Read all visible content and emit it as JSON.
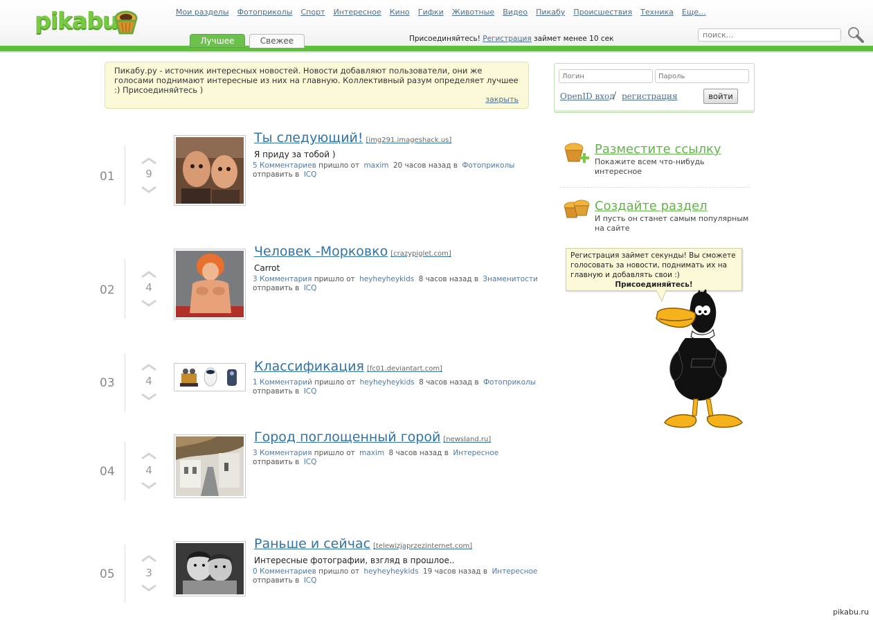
{
  "header": {
    "logo": "pikabu",
    "nav": [
      "Мои разделы",
      "Фотоприколы",
      "Спорт",
      "Интересное",
      "Кино",
      "Гифки",
      "Животные",
      "Видео",
      "Пикабу",
      "Происшествия",
      "Техника",
      "Еще..."
    ],
    "tabs": {
      "best": "Лучшее",
      "fresh": "Свежее"
    },
    "join": {
      "prefix": "Присоединяйтесь!",
      "link": "Регистрация",
      "suffix": "займет менее 10 сек"
    },
    "search_placeholder": "поиск..."
  },
  "info": {
    "text": "Пикабу.ру - источник интересных новостей. Новости добавляют пользователи, они же голосами поднимают интересные из них на главную. Коллективный разум определяет лучшее :) Присоединяйтесь )",
    "close": "закрыть"
  },
  "login": {
    "login_placeholder": "Логин",
    "password_placeholder": "Пароль",
    "openid": "OpenID вход",
    "separator": "/",
    "register": "регистрация",
    "submit": "войти"
  },
  "promo": [
    {
      "title": "Разместите ссылку",
      "desc": "Покажите всем что-нибудь интересное"
    },
    {
      "title": "Создайте раздел",
      "desc": "И пусть он станет самым популярным на сайте"
    }
  ],
  "balloon": {
    "text": "Регистрация займет секунды! Вы сможете голосовать за новости, поднимать их на главную и добавлять свои :)",
    "strong": "Присоединяйтесь!"
  },
  "meta_labels": {
    "from": "пришло от",
    "to": "в",
    "send": "отправить в",
    "icq": "ICQ"
  },
  "posts": [
    {
      "num": "01",
      "votes": "9",
      "title": "Ты следующий!",
      "domain": "[img291.imageshack.us]",
      "text": "Я приду за тобой )",
      "comments": "5 Комментариев",
      "user": "maxim",
      "time": "20 часов назад",
      "section": "Фотоприколы"
    },
    {
      "num": "02",
      "votes": "4",
      "title": "Человек -Морковко",
      "domain": "[crazypiglet.com]",
      "text": "Carrot",
      "comments": "3 Комментария",
      "user": "heyheyheykids",
      "time": "8 часов назад",
      "section": "Знаменитости"
    },
    {
      "num": "03",
      "votes": "4",
      "title": "Классификация",
      "domain": "[fc01.deviantart.com]",
      "text": "",
      "comments": "1 Комментарий",
      "user": "heyheyheykids",
      "time": "8 часов назад",
      "section": "Фотоприколы"
    },
    {
      "num": "04",
      "votes": "4",
      "title": "Город поглощенный горой",
      "domain": "[newsland.ru]",
      "text": "",
      "comments": "3 Комментария",
      "user": "maxim",
      "time": "8 часов назад",
      "section": "Интересное"
    },
    {
      "num": "05",
      "votes": "3",
      "title": "Раньше и сейчас",
      "domain": "[telewizjaprzezinternet.com]",
      "text": "Интересные фотографии, взгляд в прошлое..",
      "comments": "0 Комментариев",
      "user": "heyheyheykids",
      "time": "19 часов назад",
      "section": "Интересное"
    }
  ],
  "watermark": "pikabu.ru",
  "colors": {
    "brand_green": "#5fbf3d",
    "link_blue": "#2f73a9",
    "note_yellow": "#fcf9d8"
  }
}
